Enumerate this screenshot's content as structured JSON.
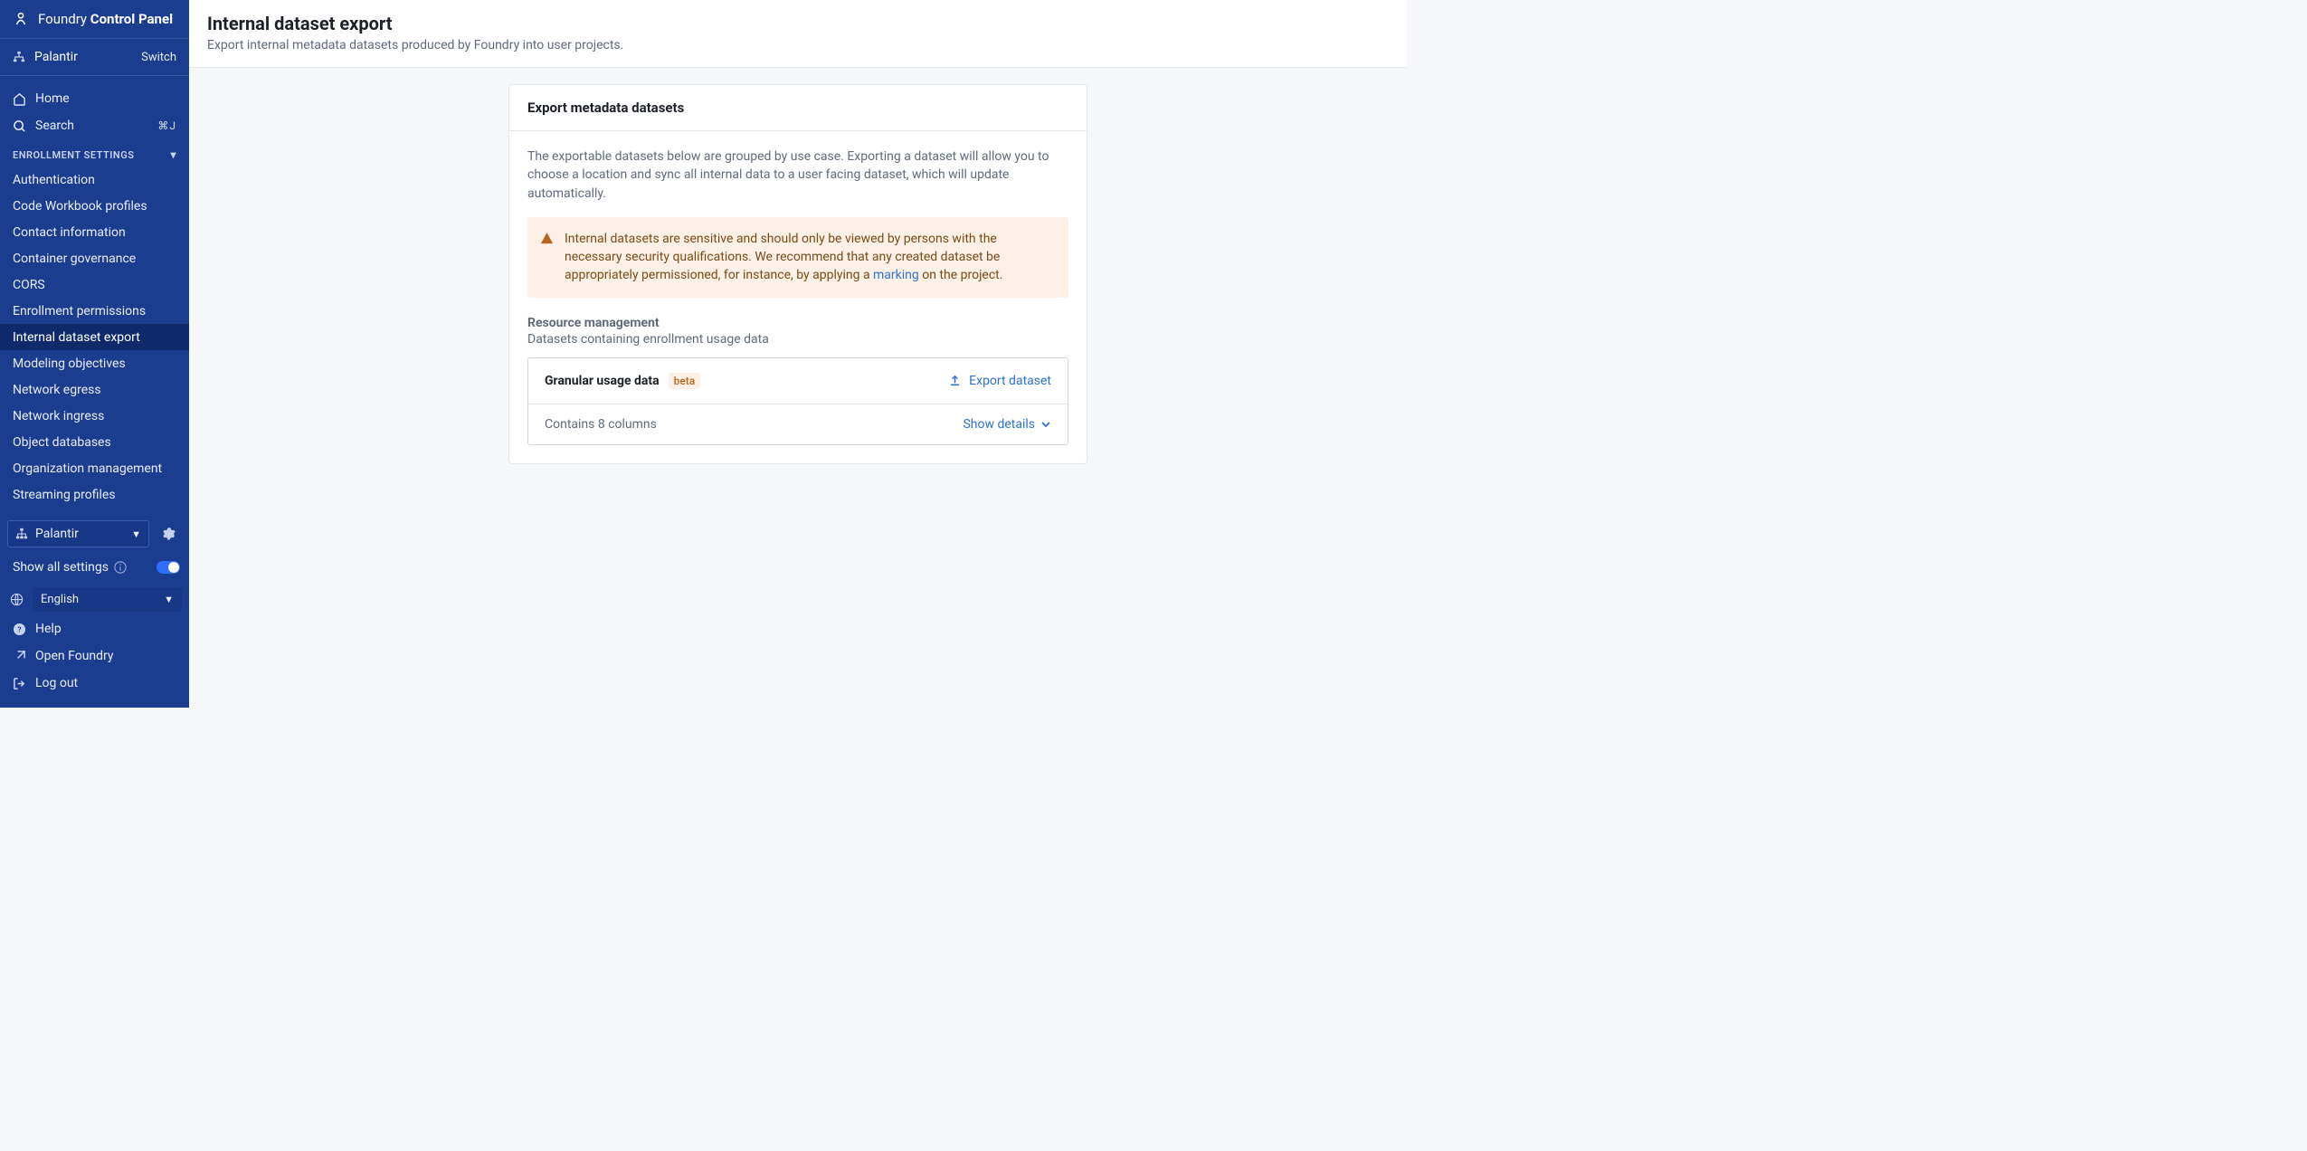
{
  "app": {
    "name_light": "Foundry ",
    "name_bold": "Control Panel"
  },
  "org": {
    "name": "Palantir",
    "switch_label": "Switch"
  },
  "sidebar": {
    "home": "Home",
    "search": "Search",
    "search_shortcut": "⌘J",
    "section_header": "ENROLLMENT SETTINGS",
    "nav_items": [
      "Authentication",
      "Code Workbook profiles",
      "Contact information",
      "Container governance",
      "CORS",
      "Enrollment permissions",
      "Internal dataset export",
      "Modeling objectives",
      "Network egress",
      "Network ingress",
      "Object databases",
      "Organization management",
      "Streaming profiles"
    ],
    "active_index": 6,
    "org_dropdown": "Palantir",
    "show_all": "Show all settings",
    "language": "English",
    "help": "Help",
    "open_foundry": "Open Foundry",
    "log_out": "Log out"
  },
  "page": {
    "title": "Internal dataset export",
    "subtitle": "Export internal metadata datasets produced by Foundry into user projects."
  },
  "card": {
    "header": "Export metadata datasets",
    "intro": "The exportable datasets below are grouped by use case. Exporting a dataset will allow you to choose a location and sync all internal data to a user facing dataset, which will update automatically.",
    "warning_part1": "Internal datasets are sensitive and should only be viewed by persons with the necessary security qualifications. We recommend that any created dataset be appropriately permissioned, for instance, by applying a ",
    "warning_link": "marking",
    "warning_part2": " on the project.",
    "section_title": "Resource management",
    "section_desc": "Datasets containing enrollment usage data",
    "dataset": {
      "title": "Granular usage data",
      "badge": "beta",
      "export_label": "Export dataset",
      "details_text": "Contains 8 columns",
      "show_details": "Show details"
    }
  }
}
